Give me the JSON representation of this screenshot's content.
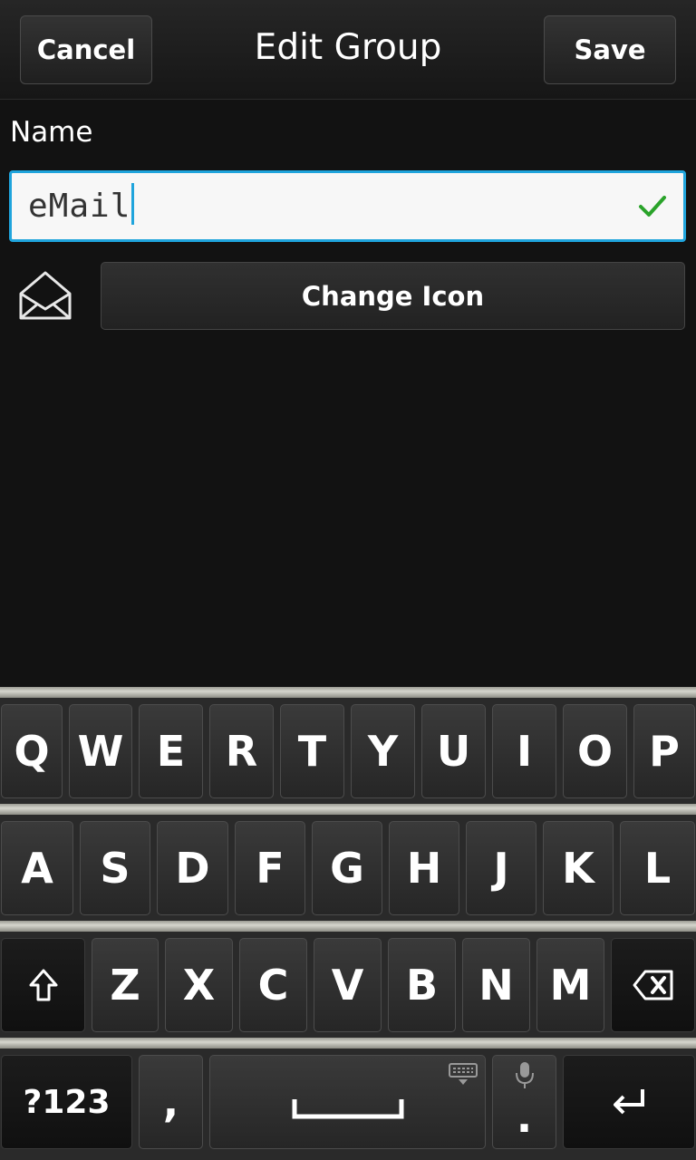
{
  "titlebar": {
    "cancel_label": "Cancel",
    "title": "Edit Group",
    "save_label": "Save"
  },
  "form": {
    "name_label": "Name",
    "name_value": "eMail",
    "change_icon_label": "Change Icon",
    "group_icon": "envelope-icon",
    "valid_icon": "check-icon"
  },
  "keyboard": {
    "row1": [
      "Q",
      "W",
      "E",
      "R",
      "T",
      "Y",
      "U",
      "I",
      "O",
      "P"
    ],
    "row2": [
      "A",
      "S",
      "D",
      "F",
      "G",
      "H",
      "J",
      "K",
      "L"
    ],
    "row3": [
      "Z",
      "X",
      "C",
      "V",
      "B",
      "N",
      "M"
    ],
    "num_label": "?123",
    "comma_label": ",",
    "period_label": ".",
    "shift_icon": "shift-icon",
    "backspace_icon": "backspace-icon",
    "enter_icon": "enter-icon",
    "space_icon": "space-icon",
    "keyboard_icon": "keyboard-icon",
    "mic_icon": "mic-icon"
  },
  "colors": {
    "accent": "#1fa4dc",
    "valid": "#2aa32a",
    "background": "#121212"
  }
}
